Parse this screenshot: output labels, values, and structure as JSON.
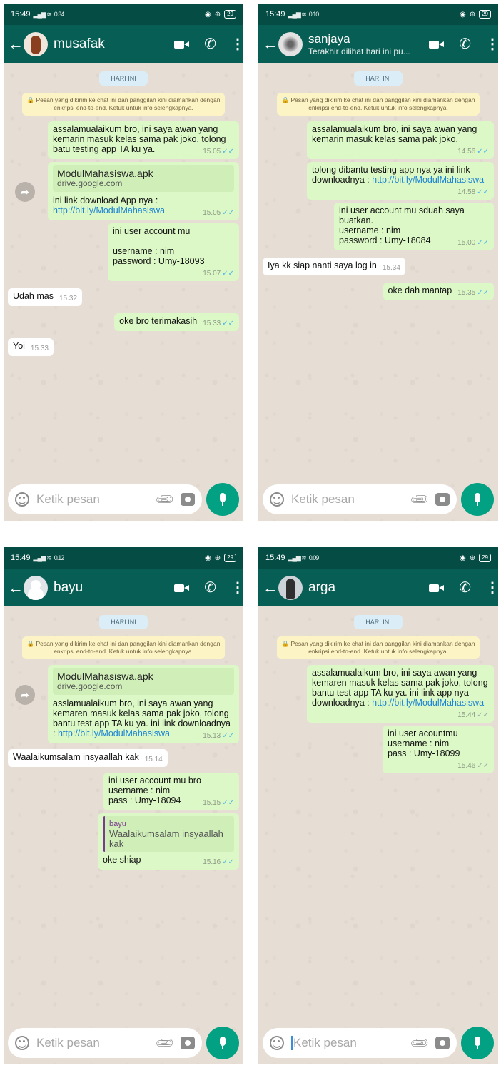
{
  "screens": [
    {
      "status": {
        "time": "15:49",
        "net": "0.34",
        "net_unit": "KB/S",
        "battery": "29"
      },
      "contact": {
        "name": "musafak",
        "subtitle": ""
      },
      "date_label": "HARI INI",
      "encryption_notice": "🔒 Pesan yang dikirim ke chat ini dan panggilan kini diamankan dengan enkripsi end-to-end. Ketuk untuk info selengkapnya.",
      "messages": [
        {
          "dir": "out",
          "text": "assalamualaikum bro, ini saya awan yang kemarin masuk kelas sama pak joko. tolong batu testing app TA ku ya.",
          "time": "15.05"
        },
        {
          "dir": "out",
          "preview_title": "ModulMahasiswa.apk",
          "preview_site": "drive.google.com",
          "text": "ini link download App nya :",
          "link": "http://bit.ly/ModulMahasiswa",
          "time": "15.05"
        },
        {
          "dir": "out",
          "text": "ini user account mu\n\nusername : nim\npassword : Umy-18093",
          "time": "15.07"
        },
        {
          "dir": "in",
          "text": "Udah mas",
          "time": "15.32"
        },
        {
          "dir": "out",
          "text": "oke bro terimakasih",
          "time": "15.33"
        },
        {
          "dir": "in",
          "text": "Yoi",
          "time": "15.33"
        }
      ],
      "input_placeholder": "Ketik pesan"
    },
    {
      "status": {
        "time": "15:49",
        "net": "0.10",
        "net_unit": "KB/S",
        "battery": "29"
      },
      "contact": {
        "name": "sanjaya",
        "subtitle": "Terakhir dilihat hari ini pu..."
      },
      "date_label": "HARI INI",
      "encryption_notice": "🔒 Pesan yang dikirim ke chat ini dan panggilan kini diamankan dengan enkripsi end-to-end. Ketuk untuk info selengkapnya.",
      "messages": [
        {
          "dir": "out",
          "text": "assalamualaikum bro, ini saya awan yang kemarin masuk kelas sama pak joko.",
          "time": "14.56"
        },
        {
          "dir": "out",
          "text": "tolong dibantu testing app nya ya ini link downloadnya :",
          "link": "http://bit.ly/ModulMahasiswa",
          "time": "14.58"
        },
        {
          "dir": "out",
          "text": "ini user account mu sduah saya buatkan.\nusername : nim\npassword : Umy-18084",
          "time": "15.00"
        },
        {
          "dir": "in",
          "text": "Iya kk siap nanti saya log in",
          "time": "15.34"
        },
        {
          "dir": "out",
          "text": "oke dah mantap",
          "time": "15.35"
        }
      ],
      "input_placeholder": "Ketik pesan"
    },
    {
      "status": {
        "time": "15:49",
        "net": "0.12",
        "net_unit": "KB/S",
        "battery": "29"
      },
      "contact": {
        "name": "bayu",
        "subtitle": ""
      },
      "date_label": "HARI INI",
      "encryption_notice": "🔒 Pesan yang dikirim ke chat ini dan panggilan kini diamankan dengan enkripsi end-to-end. Ketuk untuk info selengkapnya.",
      "messages": [
        {
          "dir": "out",
          "preview_title": "ModulMahasiswa.apk",
          "preview_site": "drive.google.com",
          "text": "asslamualaikum bro, ini saya awan yang kemaren masuk kelas sama pak joko, tolong bantu test app TA ku ya. ini link downloadnya :",
          "link": "http://bit.ly/ModulMahasiswa",
          "time": "15.13"
        },
        {
          "dir": "in",
          "text": "Waalaikumsalam insyaallah kak",
          "time": "15.14"
        },
        {
          "dir": "out",
          "text": "ini user account mu bro\nusername : nim\npass : Umy-18094",
          "time": "15.15"
        },
        {
          "dir": "out",
          "quote_name": "bayu",
          "quote_text": "Waalaikumsalam insyaallah kak",
          "text": "oke shiap",
          "time": "15.16"
        }
      ],
      "input_placeholder": "Ketik pesan"
    },
    {
      "status": {
        "time": "15:49",
        "net": "0.09",
        "net_unit": "KB/S",
        "battery": "29"
      },
      "contact": {
        "name": "arga",
        "subtitle": ""
      },
      "date_label": "HARI INI",
      "encryption_notice": "🔒 Pesan yang dikirim ke chat ini dan panggilan kini diamankan dengan enkripsi end-to-end. Ketuk untuk info selengkapnya.",
      "messages": [
        {
          "dir": "out",
          "text": "assalamualaikum bro, ini saya awan yang kemaren masuk kelas sama pak joko, tolong bantu test app TA ku ya. ini link app nya downloadnya :",
          "link": "http://bit.ly/ModulMahasiswa",
          "time": "15.44",
          "read": false
        },
        {
          "dir": "out",
          "text": "ini user acountmu\nusername : nim\npass : Umy-18099",
          "time": "15.46",
          "read": false
        }
      ],
      "input_placeholder": "Ketik pesan"
    }
  ],
  "colors": {
    "header": "#075e54",
    "status_bar": "#054d44",
    "outgoing": "#dcf8c6",
    "incoming": "#ffffff",
    "mic_button": "#03a183",
    "read_tick": "#4fb6ec"
  },
  "icons": {
    "back": "arrow-left-icon",
    "video": "video-call-icon",
    "call": "phone-icon",
    "menu": "more-vertical-icon",
    "emoji": "emoji-icon",
    "attach": "paperclip-icon",
    "camera": "camera-icon",
    "mic": "microphone-icon",
    "forward": "forward-icon"
  }
}
